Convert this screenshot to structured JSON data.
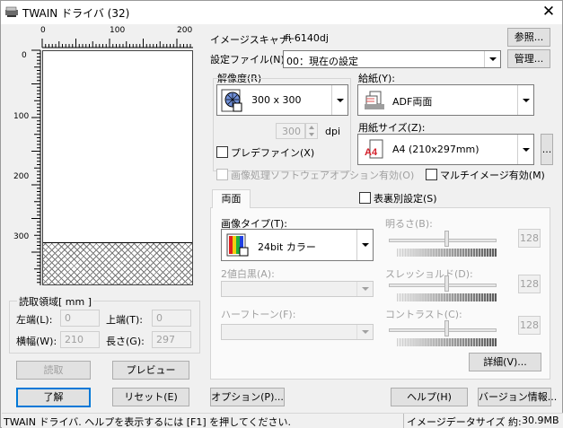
{
  "window": {
    "title": "TWAIN ドライバ (32)"
  },
  "ruler": {
    "top_ticks": [
      "0",
      "100",
      "200"
    ],
    "left_ticks": [
      "0",
      "100",
      "200",
      "300"
    ]
  },
  "scan_area": {
    "group_label": "読取領域[ mm ]",
    "left_label": "左端(L):",
    "left_value": "0",
    "top_label": "上端(T):",
    "top_value": "0",
    "width_label": "横幅(W):",
    "width_value": "210",
    "length_label": "長さ(G):",
    "length_value": "297"
  },
  "scanner": {
    "label": "イメージスキャナ:",
    "value": "fi-6140dj",
    "reference_button": "参照..."
  },
  "profile": {
    "label": "設定ファイル(N):",
    "value": "00：現在の設定",
    "manage_button": "管理..."
  },
  "resolution": {
    "label": "解像度(R)",
    "value": "300 x 300",
    "dpi_value": "300",
    "dpi_unit": "dpi",
    "prefine_label": "プレデファイン(X)"
  },
  "paper_source": {
    "label": "給紙(Y):",
    "value": "ADF両面"
  },
  "paper_size": {
    "label": "用紙サイズ(Z):",
    "value": "A4 (210x297mm)",
    "more_button": "..."
  },
  "image_processing": {
    "label": "画像処理ソフトウェアオプション有効(O)"
  },
  "multi_image": {
    "label": "マルチイメージ有効(M)"
  },
  "front_back_setting": {
    "label": "表裏別設定(S)"
  },
  "tab": {
    "label": "両面"
  },
  "image_type": {
    "label": "画像タイプ(T):",
    "value": "24bit カラー"
  },
  "binarization": {
    "label": "2値白黒(A):"
  },
  "halftone": {
    "label": "ハーフトーン(F):"
  },
  "brightness": {
    "label": "明るさ(B):",
    "value": "128"
  },
  "threshold": {
    "label": "スレッショルド(D):",
    "value": "128"
  },
  "contrast": {
    "label": "コントラスト(C):",
    "value": "128"
  },
  "buttons": {
    "details": "詳細(V)...",
    "scan": "読取",
    "preview": "プレビュー",
    "ok": "了解",
    "reset": "リセット(E)",
    "option": "オプション(P)...",
    "help": "ヘルプ(H)",
    "version": "バージョン情報..."
  },
  "status": {
    "help_text": "TWAIN ドライバ. ヘルプを表示するには [F1] を押してください.",
    "data_size_label": "イメージデータサイズ 約:",
    "data_size_value": "30.9MB"
  },
  "colors": {
    "accent": "#0078d7",
    "pdf_red": "#d3202b"
  }
}
